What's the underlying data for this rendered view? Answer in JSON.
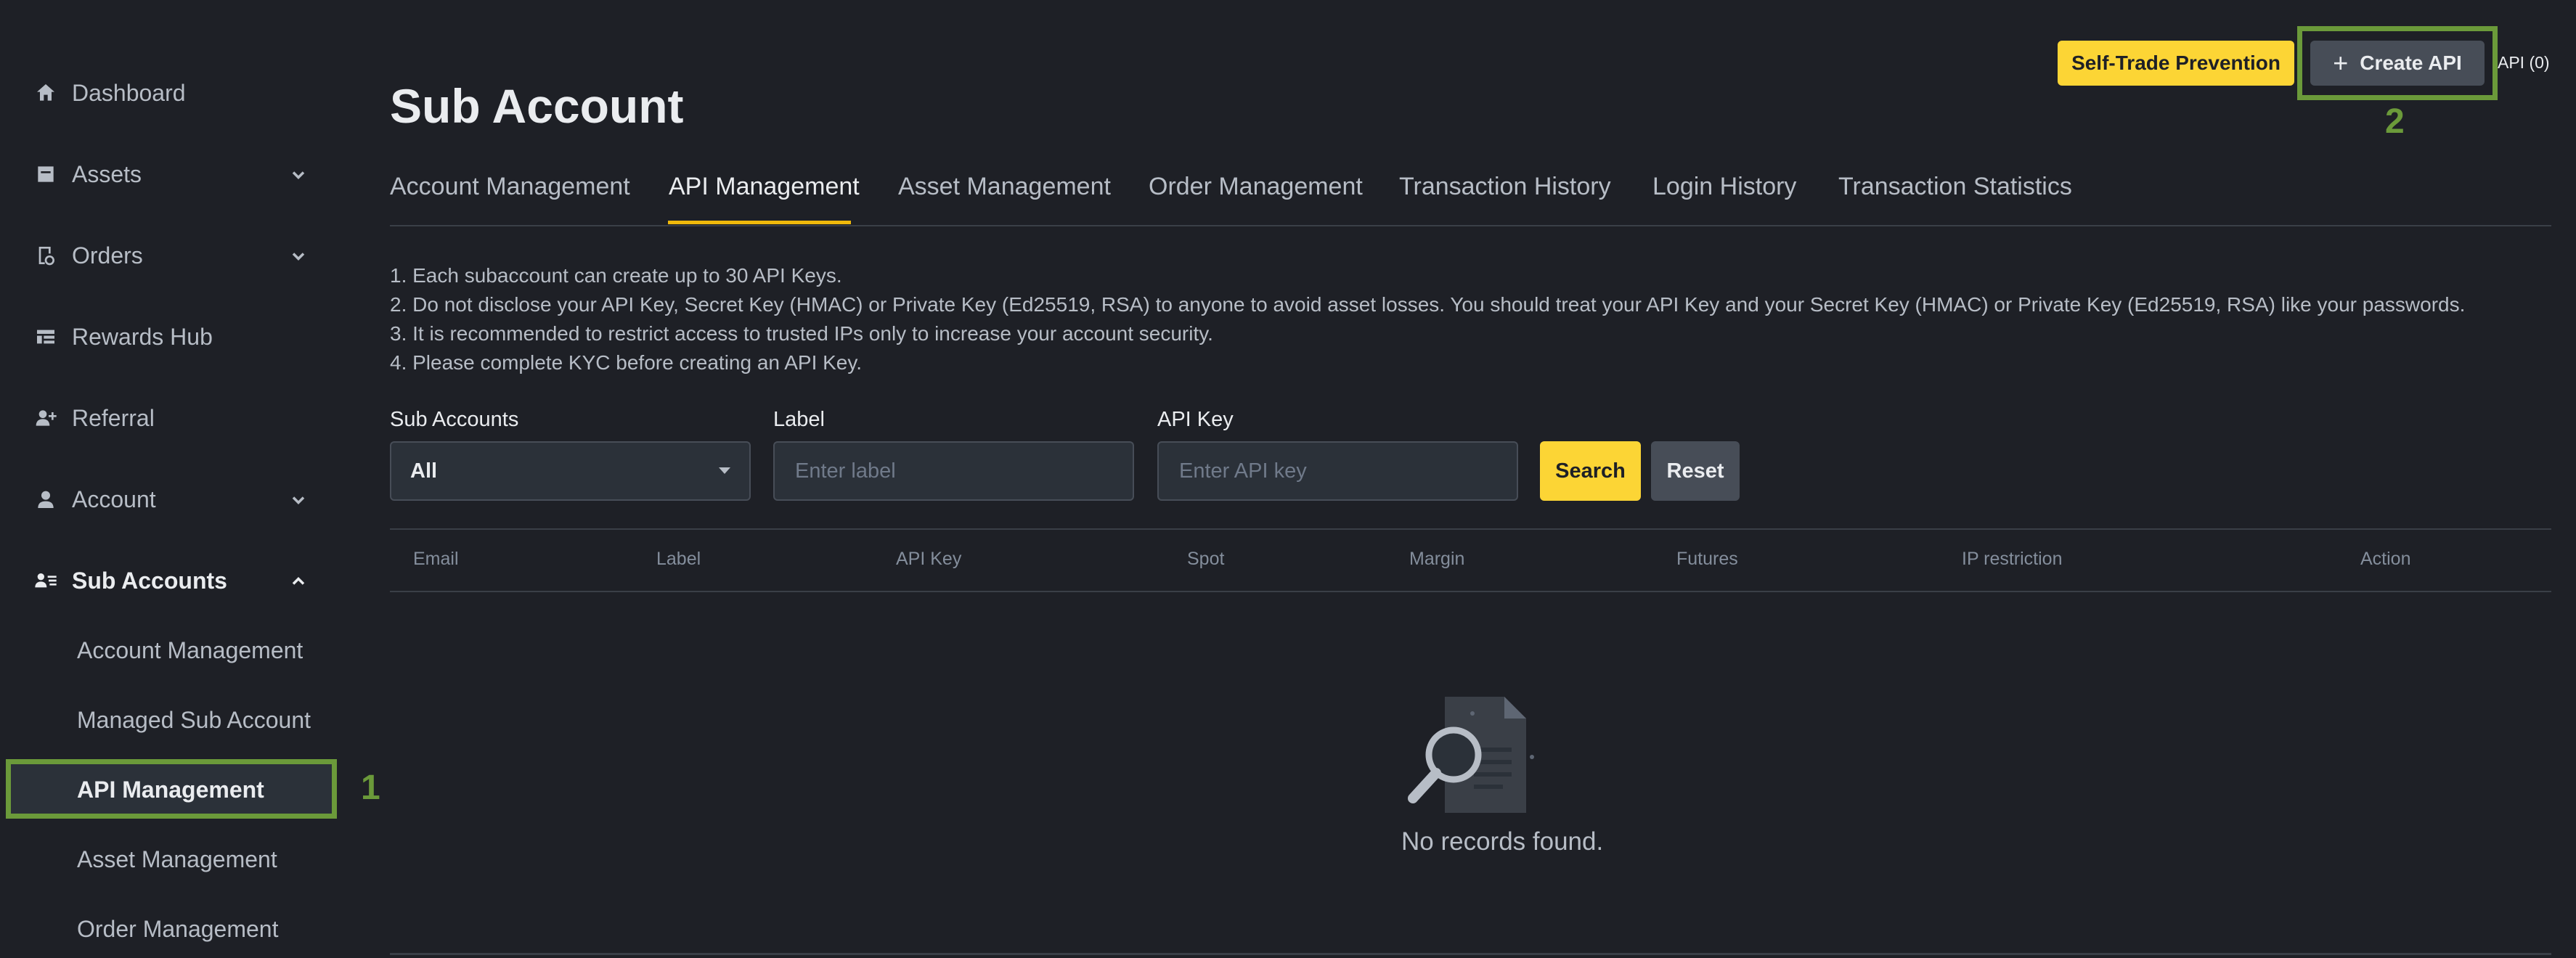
{
  "sidebar": {
    "items": [
      {
        "label": "Dashboard",
        "icon": "home-icon",
        "chevron": ""
      },
      {
        "label": "Assets",
        "icon": "wallet-icon",
        "chevron": "down"
      },
      {
        "label": "Orders",
        "icon": "orders-icon",
        "chevron": "down"
      },
      {
        "label": "Rewards Hub",
        "icon": "rewards-icon",
        "chevron": ""
      },
      {
        "label": "Referral",
        "icon": "add-user-icon",
        "chevron": ""
      },
      {
        "label": "Account",
        "icon": "user-icon",
        "chevron": "down"
      },
      {
        "label": "Sub Accounts",
        "icon": "sub-accounts-icon",
        "chevron": "up"
      }
    ],
    "sub_items": [
      {
        "label": "Account Management"
      },
      {
        "label": "Managed Sub Account"
      },
      {
        "label": "API Management"
      },
      {
        "label": "Asset Management"
      },
      {
        "label": "Order Management"
      }
    ],
    "marker_1": "1"
  },
  "header": {
    "self_trade_label": "Self-Trade Prevention",
    "create_api_label": "Create API",
    "api_count": "API (0)",
    "marker_2": "2"
  },
  "main": {
    "title": "Sub Account",
    "tabs": [
      {
        "label": "Account Management"
      },
      {
        "label": "API Management"
      },
      {
        "label": "Asset Management"
      },
      {
        "label": "Order Management"
      },
      {
        "label": "Transaction History"
      },
      {
        "label": "Login History"
      },
      {
        "label": "Transaction Statistics"
      }
    ],
    "notes": [
      "1. Each subaccount can create up to 30 API Keys.",
      "2. Do not disclose your API Key, Secret Key (HMAC) or Private Key (Ed25519, RSA) to anyone to avoid asset losses. You should treat your API Key and your Secret Key (HMAC) or Private Key (Ed25519, RSA) like your passwords.",
      "3. It is recommended to restrict access to trusted IPs only to increase your account security.",
      "4. Please complete KYC before creating an API Key."
    ],
    "filters": {
      "sub_accounts_label": "Sub Accounts",
      "sub_accounts_value": "All",
      "label_label": "Label",
      "label_placeholder": "Enter label",
      "api_key_label": "API Key",
      "api_key_placeholder": "Enter API key",
      "search_label": "Search",
      "reset_label": "Reset"
    },
    "table": {
      "columns": [
        "Email",
        "Label",
        "API Key",
        "Spot",
        "Margin",
        "Futures",
        "IP restriction",
        "Action"
      ],
      "empty_text": "No records found."
    }
  },
  "colors": {
    "background": "#1e2026",
    "accent": "#fcd535",
    "highlight": "#6b9a3a"
  }
}
